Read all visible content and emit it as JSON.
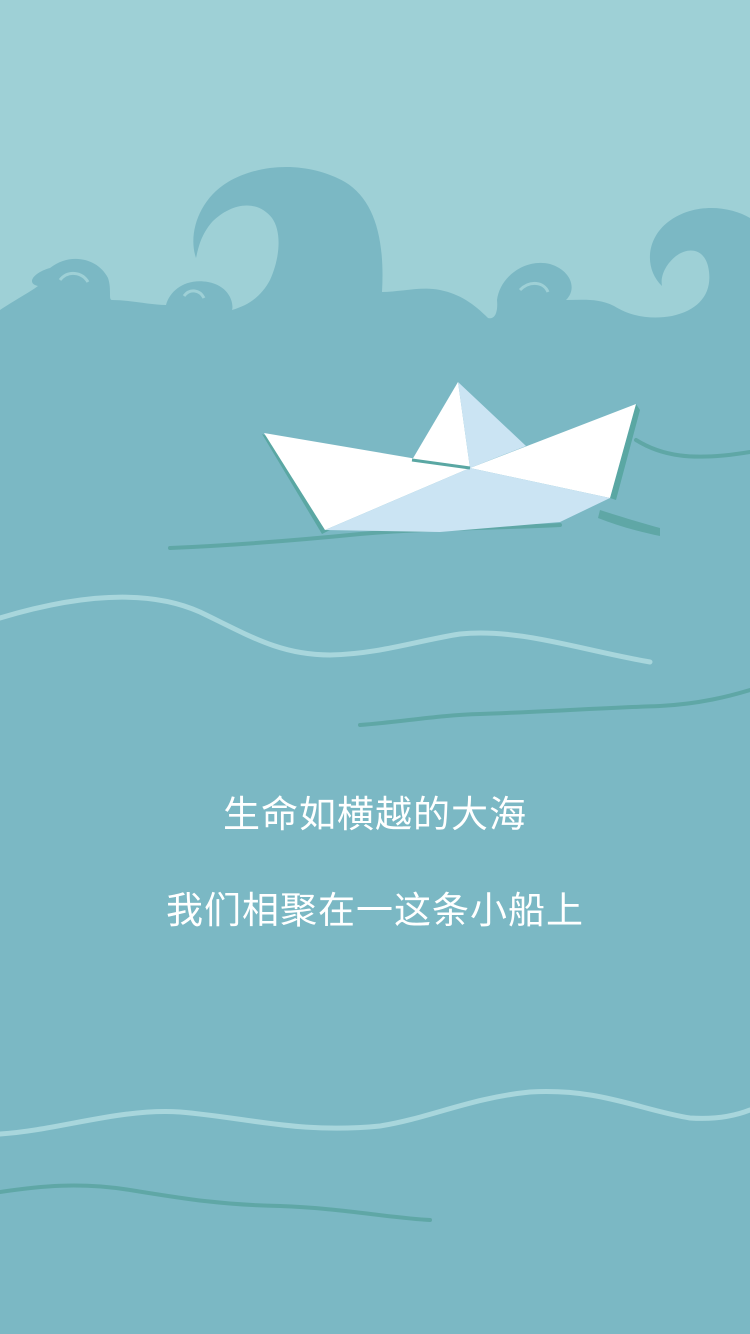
{
  "poem": {
    "line1": "生命如横越的大海",
    "line2": "我们相聚在一这条小船上"
  },
  "colors": {
    "sky": "#9ed0d6",
    "sea": "#7bb8c4",
    "wave_crest": "#7ab6c3",
    "wave_line_light": "#a8d6dc",
    "wave_line_dark": "#5fa7a6",
    "boat_white": "#ffffff",
    "boat_shade": "#cbe4f3",
    "boat_shadow": "#5aa7a3",
    "text": "#ffffff"
  }
}
